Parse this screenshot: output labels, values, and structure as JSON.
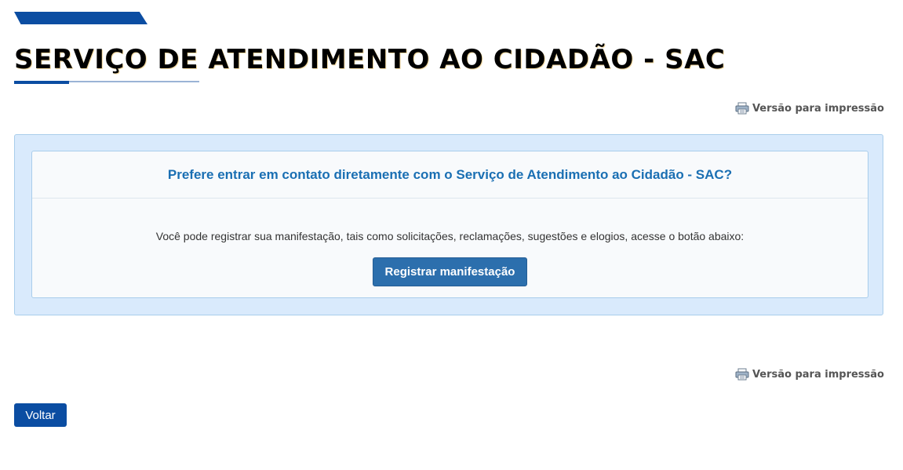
{
  "page": {
    "title": "SERVIÇO DE ATENDIMENTO AO CIDADÃO - SAC"
  },
  "print": {
    "label": "Versão para impressão",
    "icon": "printer-icon"
  },
  "sac": {
    "heading": "Prefere entrar em contato diretamente com o Serviço de Atendimento ao Cidadão - SAC?",
    "text": "Você pode registrar sua manifestação, tais como solicitações, reclamações, sugestões e elogios, acesse o botão abaixo:",
    "button_label": "Registrar manifestação"
  },
  "footer": {
    "back_label": "Voltar"
  },
  "colors": {
    "brand_blue": "#0b4da2",
    "heading_blue": "#1a6fb3",
    "panel_bg": "#d9eafc",
    "button_blue": "#2c6fad"
  }
}
